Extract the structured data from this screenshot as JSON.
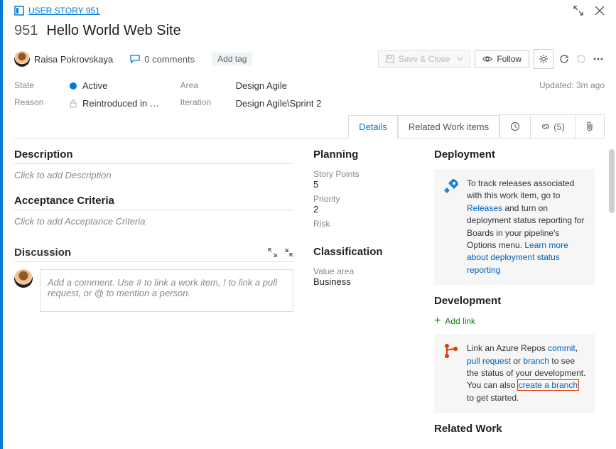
{
  "breadcrumb": {
    "label": "USER STORY 951"
  },
  "workitem": {
    "id": "951",
    "title": "Hello World Web Site"
  },
  "assignee": {
    "name": "Raisa Pokrovskaya"
  },
  "comments": {
    "count_label": "0 comments"
  },
  "add_tag": "Add tag",
  "toolbar": {
    "save": "Save & Close",
    "follow": "Follow"
  },
  "meta": {
    "state_label": "State",
    "state_value": "Active",
    "reason_label": "Reason",
    "reason_value": "Reintroduced in …",
    "area_label": "Area",
    "area_value": "Design Agile",
    "iteration_label": "Iteration",
    "iteration_value": "Design Agile\\Sprint 2",
    "updated": "Updated: 3m ago"
  },
  "tabs": {
    "details": "Details",
    "related": "Related Work items",
    "links_count": "(5)"
  },
  "description": {
    "heading": "Description",
    "placeholder": "Click to add Description"
  },
  "acceptance": {
    "heading": "Acceptance Criteria",
    "placeholder": "Click to add Acceptance Criteria"
  },
  "discussion": {
    "heading": "Discussion",
    "placeholder": "Add a comment. Use # to link a work item, ! to link a pull request, or @ to mention a person."
  },
  "planning": {
    "heading": "Planning",
    "story_points_label": "Story Points",
    "story_points_value": "5",
    "priority_label": "Priority",
    "priority_value": "2",
    "risk_label": "Risk"
  },
  "classification": {
    "heading": "Classification",
    "value_area_label": "Value area",
    "value_area_value": "Business"
  },
  "deployment": {
    "heading": "Deployment",
    "text1": "To track releases associated with this work item, go to ",
    "link1": "Releases",
    "text2": " and turn on deployment status reporting for Boards in your pipeline's Options menu. ",
    "link2": "Learn more about deployment status reporting"
  },
  "development": {
    "heading": "Development",
    "add_link": "Add link",
    "text1": "Link an Azure Repos ",
    "commit": "commit",
    "sep1": ", ",
    "pr": "pull request",
    "sep2": " or ",
    "branch": "branch",
    "text2": " to see the status of your development. You can also ",
    "create_branch": "create a branch",
    "text3": " to get started."
  },
  "related_work": {
    "heading": "Related Work"
  }
}
